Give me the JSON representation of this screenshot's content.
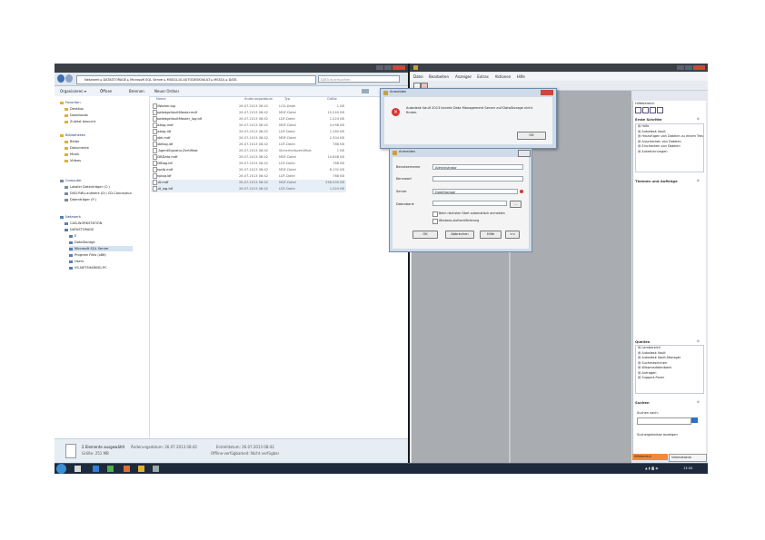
{
  "explorer": {
    "breadcrumb": [
      "Netzwerk",
      "DATASTORAGE",
      "Microsoft SQL Server",
      "MSSQL10.AUTODESKVAULT",
      "MSSQL",
      "DATA"
    ],
    "search_placeholder": "DATA durchsuchen",
    "toolbar": {
      "organize": "Organisieren ▾",
      "open": "Öffnen",
      "share": "Brennen",
      "new_folder": "Neuer Ordner"
    },
    "nav": {
      "favorites_header": "Favoriten",
      "favorites": [
        "Desktop",
        "Downloads",
        "Zuletzt besucht"
      ],
      "libraries_header": "Bibliotheken",
      "libraries": [
        "Bilder",
        "Dokumente",
        "Musik",
        "Videos"
      ],
      "computer_header": "Computer",
      "computer": [
        "Lokaler Datenträger (C:)",
        "DVD-RW-Laufwerk (D:) CD-Conceptua",
        "Datenträger (F:)"
      ],
      "network_header": "Netzwerk",
      "network": [
        "CAD-WORKSTATION",
        "DATASTORAGE",
        "E",
        "DataStorage",
        "Microsoft SQL Server",
        "Program Files (x86)",
        "Users",
        "VS-NETSHARING-PC"
      ]
    },
    "columns": {
      "name": "Name",
      "date": "Änderungsdatum",
      "type": "Typ",
      "size": "Größe"
    },
    "files": [
      {
        "name": "FileWorker.log",
        "date": "26.07.2013 08:42",
        "type": "LOG-Datei",
        "size": "1 KB"
      },
      {
        "name": "KnowledgeVaultMaster.mdf",
        "date": "26.07.2013 08:42",
        "type": "MDF-Datei",
        "size": "10.240 KB"
      },
      {
        "name": "KnowledgeVaultMaster_log.ldf",
        "date": "26.07.2013 08:42",
        "type": "LDF-Datei",
        "size": "1.024 KB"
      },
      {
        "name": "mastlog.mdf",
        "date": "26.07.2013 08:42",
        "type": "MDF-Datei",
        "size": "4.096 KB"
      },
      {
        "name": "mastlog.ldf",
        "date": "26.07.2013 08:42",
        "type": "LDF-Datei",
        "size": "1.280 KB"
      },
      {
        "name": "model.mdf",
        "date": "26.07.2013 08:42",
        "type": "MDF-Datei",
        "size": "2.304 KB"
      },
      {
        "name": "modellog.ldf",
        "date": "26.07.2013 08:42",
        "type": "LDF-Datei",
        "size": "768 KB"
      },
      {
        "name": "MS AgentSignatur.Zertifikat",
        "date": "26.07.2013 08:42",
        "type": "Sicherheitszertifikat",
        "size": "1 KB"
      },
      {
        "name": "MSDBData.mdf",
        "date": "26.07.2013 08:42",
        "type": "MDF-Datei",
        "size": "14.848 KB"
      },
      {
        "name": "MSDBlog.ldf",
        "date": "26.07.2013 08:42",
        "type": "LDF-Datei",
        "size": "768 KB"
      },
      {
        "name": "tempdb.mdf",
        "date": "26.07.2013 08:42",
        "type": "MDF-Datei",
        "size": "8.192 KB"
      },
      {
        "name": "templog.ldf",
        "date": "26.07.2013 08:42",
        "type": "LDF-Datei",
        "size": "768 KB"
      },
      {
        "name": "Vault.mdf",
        "date": "26.07.2013 08:42",
        "type": "MDF-Datei",
        "size": "256.000 KB"
      },
      {
        "name": "Vault_log.ldf",
        "date": "26.07.2013 08:42",
        "type": "LDF-Datei",
        "size": "1.024 KB"
      }
    ],
    "status": {
      "selection": "2 Elemente ausgewählt",
      "modified": "Änderungsdatum: 26.07.2013 08:42",
      "size": "Größe: 251 MB",
      "created": "Erstelldatum: 26.07.2013 08:42",
      "offline": "Offline-verfügbarkeit: Nicht verfügbar"
    }
  },
  "vault": {
    "menu": [
      "Datei",
      "Bearbeiten",
      "Anzeigen",
      "Extras",
      "Aktionen",
      "Hilfe"
    ],
    "side_header": "Hilfebereich",
    "first_steps_header": "Erste Schritte",
    "first_steps": [
      "Hilfe",
      "Autodesk Vault",
      "Hinzufügen von Dateien zu einem Tresor",
      "Auschecken von Dateien",
      "Einchecken von Dateien",
      "Aufzeichnungen"
    ],
    "related_header": "Themen und Aufträge",
    "sources_header": "Quellen",
    "sources": [
      "Lernbereich",
      "Autodesk Vault",
      "Autodesk Vault-Manager",
      "Suchmaschinen",
      "Wissensdatenbank",
      "Anfragen",
      "Support-Foren"
    ],
    "search_header": "Suchen",
    "search_label": "Suchen nach:",
    "search_prompt": "Suchergebnisse anzeigen",
    "tabs": [
      "Hilfebereich",
      "Informationen"
    ]
  },
  "error_dialog": {
    "title": "Anmelden",
    "message": "Autodesk Vault 2013 konnte Data Management Server auf DataStorage nicht finden.",
    "ok": "OK"
  },
  "login_dialog": {
    "title": "Anmelden",
    "user_label": "Benutzername",
    "user_value": "Administrator",
    "password_label": "Kennwort",
    "server_label": "Server",
    "server_value": "DataStorage",
    "vault_label": "Datenbank",
    "auto_login": "Beim nächsten Start automatisch anmelden",
    "windows_auth": "Windows-Authentifizierung",
    "ok": "OK",
    "cancel": "Abbrechen",
    "help": "Hilfe",
    "more": "<<"
  },
  "taskbar": {
    "time": "13:34"
  }
}
